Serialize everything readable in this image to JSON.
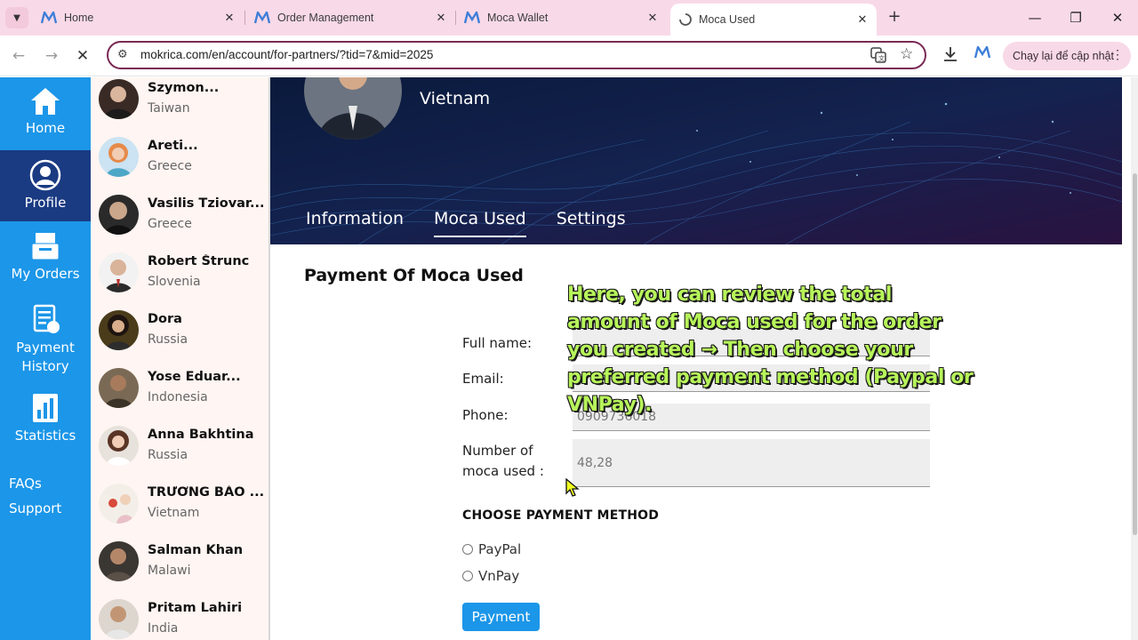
{
  "browser": {
    "tabs": [
      {
        "title": "Home",
        "active": false
      },
      {
        "title": "Order Management",
        "active": false
      },
      {
        "title": "Moca Wallet",
        "active": false
      },
      {
        "title": "Moca Used",
        "active": true
      }
    ],
    "url": "mokrica.com/en/account/for-partners/?tid=7&mid=2025",
    "update_button": "Chạy lại để cập nhật",
    "brand_color": "#3f7fd8"
  },
  "sidebar": {
    "items": [
      {
        "label": "Home",
        "icon": "home-icon"
      },
      {
        "label": "Profile",
        "icon": "user-icon"
      },
      {
        "label": "My Orders",
        "icon": "orders-icon"
      },
      {
        "label": "Payment History",
        "icon": "payment-history-icon"
      },
      {
        "label": "Statistics",
        "icon": "statistics-icon"
      }
    ],
    "links": [
      "FAQs",
      "Support"
    ],
    "color": "#1c96e8",
    "active_color": "#1a3a82"
  },
  "partners": [
    {
      "name": "Szymon...",
      "country": "Taiwan"
    },
    {
      "name": "Areti...",
      "country": "Greece"
    },
    {
      "name": "Vasilis Tziovar...",
      "country": "Greece"
    },
    {
      "name": "Robert Štrunc",
      "country": "Slovenia"
    },
    {
      "name": "Dora",
      "country": "Russia"
    },
    {
      "name": "Yose Eduar...",
      "country": "Indonesia"
    },
    {
      "name": "Anna Bakhtina",
      "country": "Russia"
    },
    {
      "name": "TRƯƠNG BẢO ...",
      "country": "Vietnam"
    },
    {
      "name": "Salman Khan",
      "country": "Malawi"
    },
    {
      "name": "Pritam Lahiri",
      "country": "India"
    }
  ],
  "profile": {
    "country": "Vietnam",
    "tabs": [
      "Information",
      "Moca Used",
      "Settings"
    ],
    "active_tab": "Moca Used"
  },
  "payment": {
    "title": "Payment Of Moca Used",
    "fields": {
      "full_name": {
        "label": "Full name:",
        "value": ""
      },
      "email": {
        "label": "Email:",
        "value": ""
      },
      "phone": {
        "label": "Phone:",
        "value": "0909736018"
      },
      "moca_used": {
        "label": "Number of moca used :",
        "value": "48,28"
      }
    },
    "method_title": "CHOOSE PAYMENT METHOD",
    "methods": [
      "PayPal",
      "VnPay"
    ],
    "submit": "Payment"
  },
  "overlay_caption": "Here, you can review the total amount of Moca used for the order you created → Then choose your preferred payment method (Paypal or VNPay)."
}
